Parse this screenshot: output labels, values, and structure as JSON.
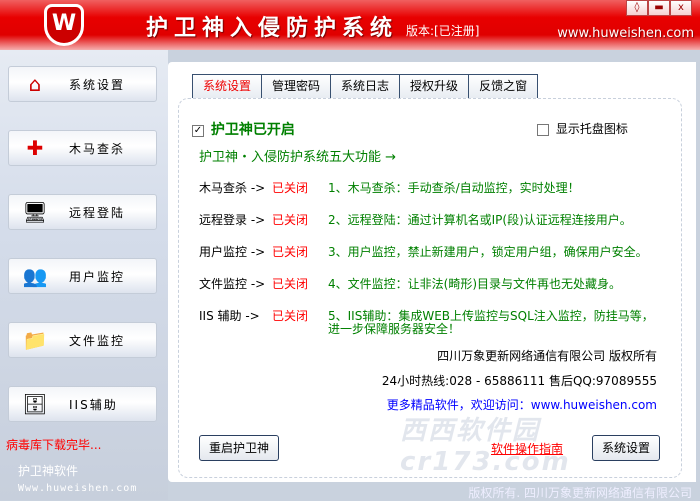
{
  "titlebar": {
    "logo_letter": "W",
    "title": "护卫神入侵防护系统",
    "version": "版本:[已注册]",
    "site": "www.huweishen.com",
    "window_buttons": [
      "◊",
      "▬",
      "x"
    ]
  },
  "sidebar": {
    "items": [
      {
        "label": "系统设置",
        "icon": "home-icon",
        "glyph": "⌂"
      },
      {
        "label": "木马查杀",
        "icon": "medical-kit-icon",
        "glyph": "✚"
      },
      {
        "label": "远程登陆",
        "icon": "remote-computer-icon",
        "glyph": "🖥"
      },
      {
        "label": "用户监控",
        "icon": "users-icon",
        "glyph": "👥"
      },
      {
        "label": "文件监控",
        "icon": "folder-clock-icon",
        "glyph": "📁"
      },
      {
        "label": "IIS辅助",
        "icon": "server-icon",
        "glyph": "🗄"
      }
    ],
    "status": "病毒库下载完毕...",
    "brand": "护卫神软件",
    "brand_url": "Www.huweishen.com"
  },
  "tabs": [
    {
      "label": "系统设置",
      "active": true
    },
    {
      "label": "管理密码"
    },
    {
      "label": "系统日志"
    },
    {
      "label": "授权升级"
    },
    {
      "label": "反馈之窗"
    }
  ],
  "content": {
    "enabled_label": "护卫神已开启",
    "enabled_check": "✓",
    "tray_label": "显示托盘图标",
    "heading": "护卫神・入侵防护系统五大功能 →",
    "features": [
      {
        "name": "木马查杀 ->",
        "state": "已关闭",
        "desc": "1、木马查杀：手动查杀/自动监控，实时处理！"
      },
      {
        "name": "远程登录 ->",
        "state": "已关闭",
        "desc": "2、远程登陆：通过计算机名或IP(段)认证远程连接用户。"
      },
      {
        "name": "用户监控 ->",
        "state": "已关闭",
        "desc": "3、用户监控，禁止新建用户，锁定用户组，确保用户安全。"
      },
      {
        "name": "文件监控 ->",
        "state": "已关闭",
        "desc": "4、文件监控：让非法(畸形)目录与文件再也无处藏身。"
      },
      {
        "name": "IIS 辅助 ->",
        "state": "已关闭",
        "desc": "5、IIS辅助：集成WEB上传监控与SQL注入监控，防挂马等，",
        "desc2": "进一步保障服务器安全！"
      }
    ],
    "company": "四川万象更新网络通信有限公司 版权所有",
    "hotline": "24小时热线:028 - 65886111  售后QQ:97089555",
    "more": "更多精品软件，欢迎访问：www.huweishen.com",
    "restart_button": "重启护卫神",
    "guide_link": "软件操作指南",
    "settings_button": "系统设置"
  },
  "watermark": "西西软件园 cr173.com",
  "footer": "版权所有. 四川万象更新网络通信有限公司"
}
